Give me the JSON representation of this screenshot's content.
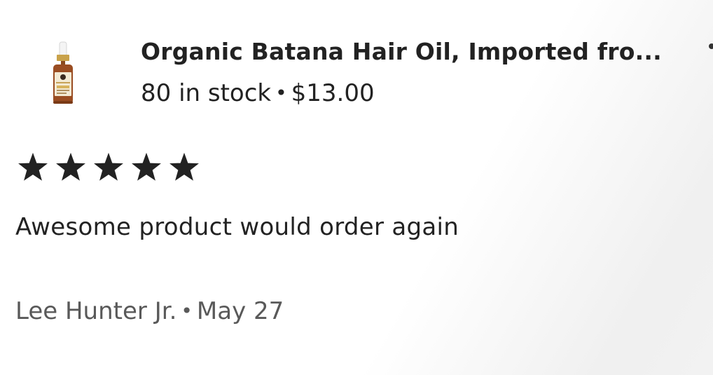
{
  "product": {
    "title": "Organic Batana Hair Oil, Imported fro...",
    "stock": "80 in stock",
    "separator": "•",
    "price": "$13.00",
    "thumbnail_icon": "oil-bottle-image"
  },
  "review": {
    "rating": 5,
    "rating_max": 5,
    "star_color": "#222222",
    "text": "Awesome product would order again",
    "reviewer": "Lee Hunter Jr.",
    "separator": "•",
    "date": "May 27"
  }
}
